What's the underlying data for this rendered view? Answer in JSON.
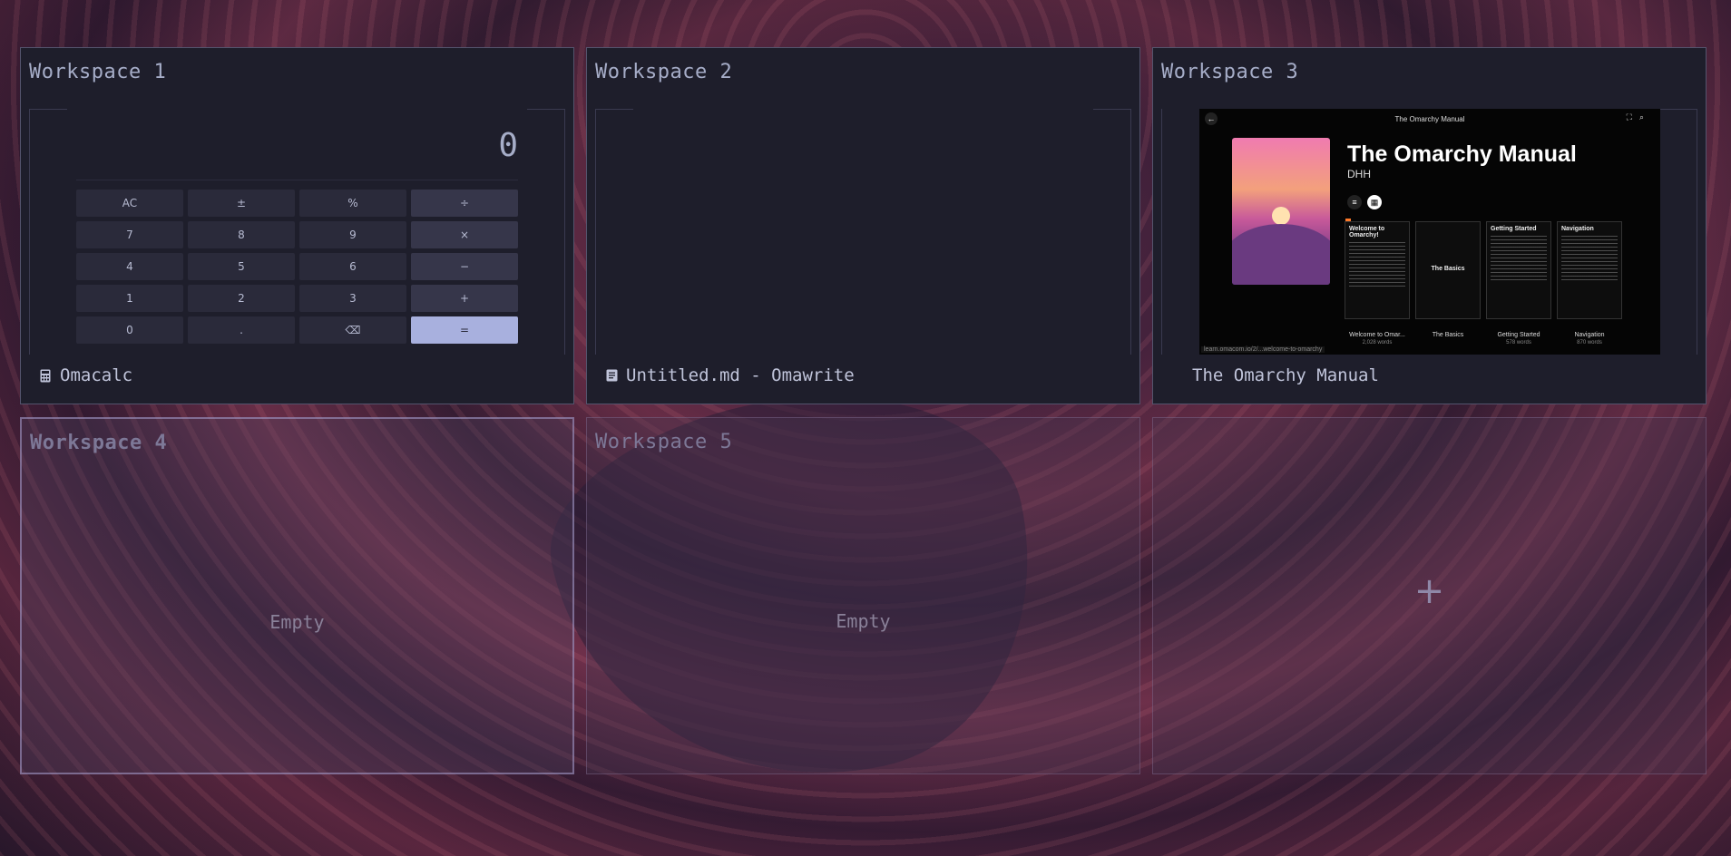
{
  "workspaces": [
    {
      "title": "Workspace 1",
      "app": "Omacalc",
      "icon": "calculator-icon"
    },
    {
      "title": "Workspace 2",
      "app": "Untitled.md - Omawrite",
      "icon": "document-icon"
    },
    {
      "title": "Workspace 3",
      "app": "The Omarchy Manual",
      "icon": "book-icon"
    },
    {
      "title": "Workspace 4",
      "empty_label": "Empty",
      "active": true
    },
    {
      "title": "Workspace 5",
      "empty_label": "Empty"
    },
    {
      "add_label": "+"
    }
  ],
  "calculator": {
    "display": "0",
    "keys": [
      "AC",
      "±",
      "%",
      "÷",
      "7",
      "8",
      "9",
      "×",
      "4",
      "5",
      "6",
      "−",
      "1",
      "2",
      "3",
      "+",
      "0",
      ".",
      "⌫",
      "="
    ]
  },
  "manual": {
    "header": "The Omarchy Manual",
    "title": "The Omarchy Manual",
    "author": "DHH",
    "cards": [
      {
        "title": "Welcome to Omarchy!",
        "caption": "Welcome to Omar...",
        "sub": "2,028 words"
      },
      {
        "title": "The Basics",
        "caption": "The Basics",
        "sub": ""
      },
      {
        "title": "Getting Started",
        "caption": "Getting Started",
        "sub": "578 words"
      },
      {
        "title": "Navigation",
        "caption": "Navigation",
        "sub": "870 words"
      }
    ],
    "url": "learn.omacom.io/2/...welcome-to-omarchy"
  },
  "colors": {
    "active_title": "#7aa2f7",
    "equals_key": "#a8b0de",
    "window_bg": "#1e1e2b"
  }
}
